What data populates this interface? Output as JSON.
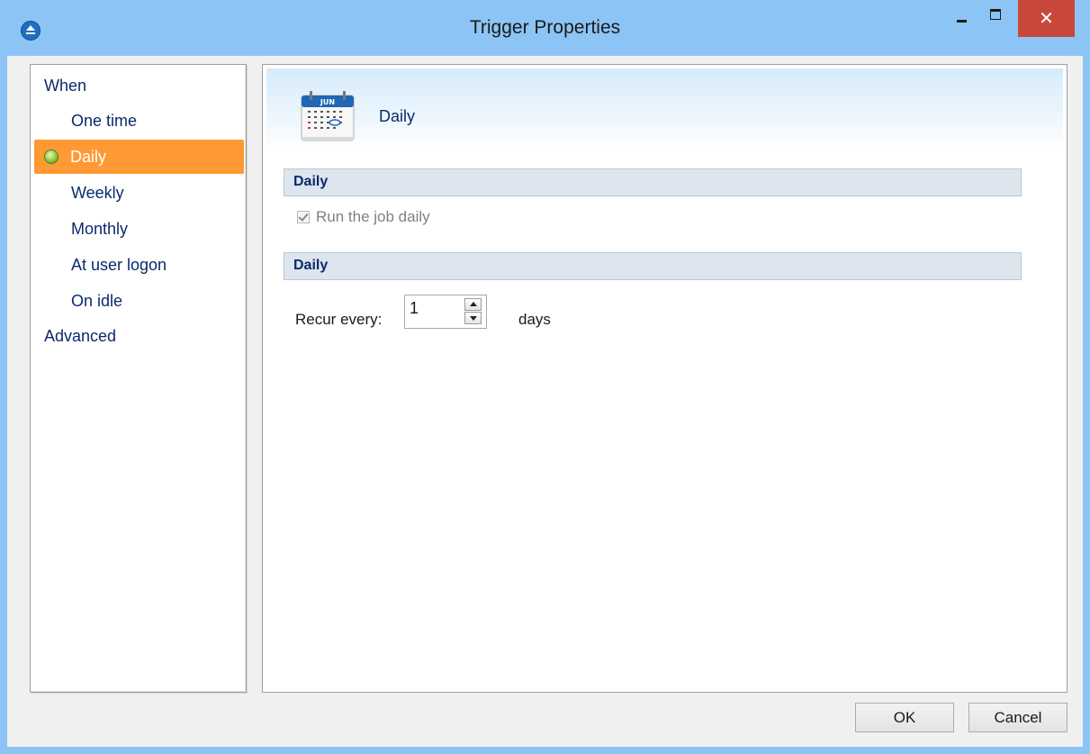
{
  "window": {
    "title": "Trigger Properties",
    "close_glyph": "✕"
  },
  "sidebar": {
    "items": [
      {
        "label": "When",
        "level": "top",
        "selected": false
      },
      {
        "label": "One time",
        "level": "sub",
        "selected": false
      },
      {
        "label": "Daily",
        "level": "sub",
        "selected": true
      },
      {
        "label": "Weekly",
        "level": "sub",
        "selected": false
      },
      {
        "label": "Monthly",
        "level": "sub",
        "selected": false
      },
      {
        "label": "At user logon",
        "level": "sub",
        "selected": false
      },
      {
        "label": "On idle",
        "level": "sub",
        "selected": false
      },
      {
        "label": "Advanced",
        "level": "top",
        "selected": false
      }
    ],
    "selected_color": "#ff9933"
  },
  "header": {
    "title": "Daily",
    "calendar_month": "JUN",
    "icon": "calendar-icon"
  },
  "sections": [
    {
      "title": "Daily"
    },
    {
      "title": "Daily"
    }
  ],
  "run_daily": {
    "label": "Run the job daily",
    "checked": true,
    "disabled": true
  },
  "recur": {
    "label": "Recur every:",
    "value": "1",
    "unit": "days"
  },
  "buttons": {
    "ok": "OK",
    "cancel": "Cancel"
  },
  "colors": {
    "title_bar": "#8cc4f5",
    "close_button": "#c7483a",
    "section_header": "#dde6ee",
    "link_text": "#0a2a6b"
  }
}
